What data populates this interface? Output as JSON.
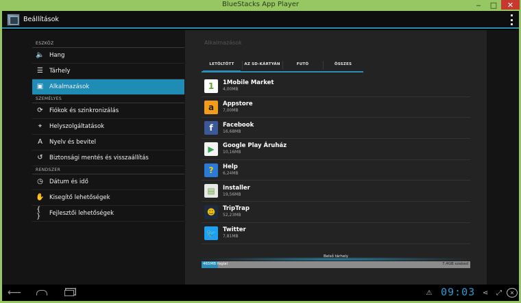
{
  "window": {
    "title": "BlueStacks App Player",
    "min": "‒",
    "max": "□",
    "close": "✕"
  },
  "actionbar": {
    "title": "Beállítások"
  },
  "sidebar": {
    "sections": [
      {
        "header": "ESZKÖZ",
        "items": [
          {
            "icon": "speaker-icon",
            "glyph": "🔈",
            "label": "Hang"
          },
          {
            "icon": "storage-icon",
            "glyph": "☰",
            "label": "Tárhely"
          },
          {
            "icon": "apps-icon",
            "glyph": "▣",
            "label": "Alkalmazások",
            "selected": true
          }
        ]
      },
      {
        "header": "SZEMÉLYES",
        "items": [
          {
            "icon": "sync-icon",
            "glyph": "⟳",
            "label": "Fiókok és szinkronizálás"
          },
          {
            "icon": "location-icon",
            "glyph": "⌖",
            "label": "Helyszolgáltatások"
          },
          {
            "icon": "language-icon",
            "glyph": "A",
            "label": "Nyelv és bevitel"
          },
          {
            "icon": "backup-icon",
            "glyph": "↺",
            "label": "Biztonsági mentés és visszaállítás"
          }
        ]
      },
      {
        "header": "RENDSZER",
        "items": [
          {
            "icon": "clock-icon",
            "glyph": "◷",
            "label": "Dátum és idő"
          },
          {
            "icon": "hand-icon",
            "glyph": "✋",
            "label": "Kisegítő lehetőségek"
          },
          {
            "icon": "braces-icon",
            "glyph": "{ }",
            "label": "Fejlesztői lehetőségek"
          }
        ]
      }
    ]
  },
  "panel": {
    "title": "Alkalmazások",
    "tabs": [
      {
        "label": "LETÖLTÖTT",
        "active": true
      },
      {
        "label": "AZ SD-KÁRTYÁN"
      },
      {
        "label": "FUTÓ"
      },
      {
        "label": "ÖSSZES"
      }
    ],
    "apps": [
      {
        "name": "1Mobile Market",
        "size": "4,00MB",
        "icon": "1mobile-icon",
        "glyph": "1",
        "color": "#ffffff",
        "fg": "#5da52e"
      },
      {
        "name": "Appstore",
        "size": "7,00MB",
        "icon": "amazon-icon",
        "glyph": "a",
        "color": "#f59b1a",
        "fg": "#222222"
      },
      {
        "name": "Facebook",
        "size": "16,68MB",
        "icon": "facebook-icon",
        "glyph": "f",
        "color": "#3b5998",
        "fg": "#ffffff"
      },
      {
        "name": "Google Play Áruház",
        "size": "10,16MB",
        "icon": "google-play-icon",
        "glyph": "▶",
        "color": "#f3f3f3",
        "fg": "#34a853"
      },
      {
        "name": "Help",
        "size": "6,24MB",
        "icon": "help-icon",
        "glyph": "?",
        "color": "#2b7bd6",
        "fg": "#f5d000"
      },
      {
        "name": "Installer",
        "size": "19,56MB",
        "icon": "installer-icon",
        "glyph": "▤",
        "color": "#e8e8e8",
        "fg": "#6aa93a"
      },
      {
        "name": "TripTrap",
        "size": "52,23MB",
        "icon": "triptrap-icon",
        "glyph": "☻",
        "color": "#1e2a40",
        "fg": "#f2c200"
      },
      {
        "name": "Twitter",
        "size": "7,81MB",
        "icon": "twitter-icon",
        "glyph": "🐦",
        "color": "#1da1f2",
        "fg": "#ffffff"
      }
    ],
    "storage": {
      "label": "Belső tárhely",
      "used": "465MB",
      "used_unit": "foglal",
      "free": "7,4GB szabad",
      "used_fraction": 0.06
    }
  },
  "navbar": {
    "clock": "09:03",
    "back": "⟵",
    "warn": "⚠",
    "share": "⋖",
    "resize": "⤢",
    "close": "✕"
  },
  "colors": {
    "accent": "#2b8fb7",
    "frame": "#97c763"
  }
}
